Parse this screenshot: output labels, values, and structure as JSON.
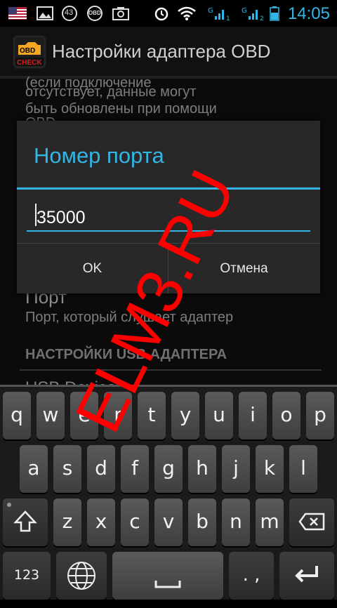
{
  "status_bar": {
    "time": "14:05",
    "badge_count": "43",
    "obd_label": "OBD",
    "icons": [
      "flag-us-icon",
      "image-icon",
      "counter-badge-icon",
      "obd-icon",
      "camera-icon",
      "alarm-icon",
      "wifi-icon",
      "signal-1-icon",
      "signal-2-icon",
      "battery-icon"
    ]
  },
  "action_bar": {
    "title": "Настройки адаптера OBD",
    "app_icon_text_top": "OBD",
    "app_icon_text_bottom": "CHECK"
  },
  "background_list": {
    "desc_line1": "(если подключение",
    "desc_line2": "отсутствует, данные могут",
    "desc_line3": "быть обновлены при помощи",
    "desc_line4": "OBD",
    "port_title": "Порт",
    "port_summary": "Порт, который слушает адаптер",
    "usb_header": "НАСТРОЙКИ USB АДАПТЕРА",
    "usb_item": "USB Device"
  },
  "dialog": {
    "title": "Номер порта",
    "input_value": "35000",
    "ok_label": "OK",
    "cancel_label": "Отмена"
  },
  "watermark": "ELM3.RU",
  "keyboard": {
    "row1": [
      "q",
      "w",
      "e",
      "r",
      "t",
      "y",
      "u",
      "i",
      "o",
      "p"
    ],
    "row2": [
      "a",
      "s",
      "d",
      "f",
      "g",
      "h",
      "j",
      "k",
      "l"
    ],
    "row3": [
      "z",
      "x",
      "c",
      "v",
      "b",
      "n",
      "m"
    ],
    "numbers_label": "123",
    "punctuation_label": ". ,",
    "icons": [
      "shift-icon",
      "backspace-icon",
      "globe-icon",
      "space-icon",
      "enter-icon"
    ]
  },
  "colors": {
    "accent": "#33b5e5",
    "watermark": "#ff0000"
  }
}
